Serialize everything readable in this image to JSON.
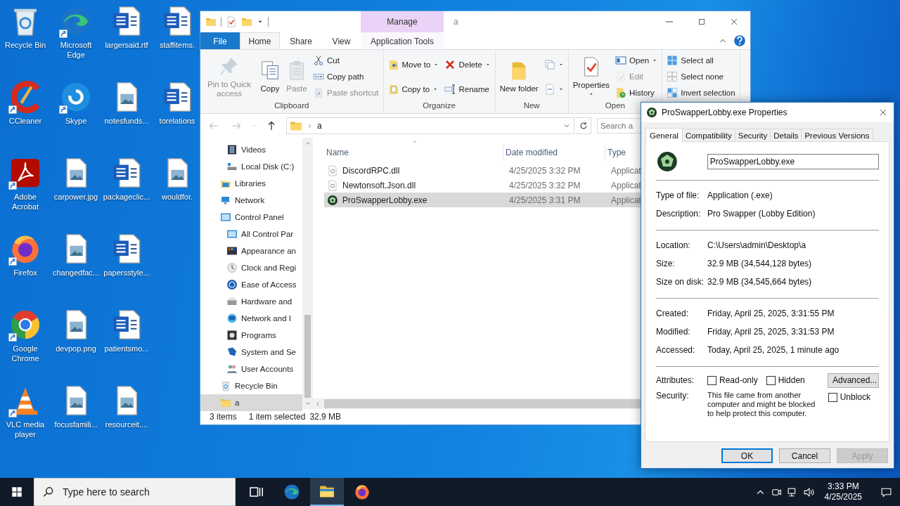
{
  "desktop": {
    "icons": [
      {
        "label": "Recycle Bin",
        "kind": "recycle",
        "shortcut": false
      },
      {
        "label": "CCleaner",
        "kind": "ccleaner",
        "shortcut": true
      },
      {
        "label": "Adobe Acrobat",
        "kind": "acrobat",
        "shortcut": true
      },
      {
        "label": "Firefox",
        "kind": "firefox",
        "shortcut": true
      },
      {
        "label": "Google Chrome",
        "kind": "chrome",
        "shortcut": true
      },
      {
        "label": "VLC media player",
        "kind": "vlc",
        "shortcut": true
      },
      {
        "label": "Microsoft Edge",
        "kind": "edge",
        "shortcut": true
      },
      {
        "label": "Skype",
        "kind": "skype",
        "shortcut": true
      },
      {
        "label": "carpower.jpg",
        "kind": "image",
        "shortcut": false
      },
      {
        "label": "changedfac...",
        "kind": "image",
        "shortcut": false
      },
      {
        "label": "devpop.png",
        "kind": "image",
        "shortcut": false
      },
      {
        "label": "focusfamili...",
        "kind": "image",
        "shortcut": false
      },
      {
        "label": "largersaid.rtf",
        "kind": "word",
        "shortcut": false
      },
      {
        "label": "notesfunds...",
        "kind": "image",
        "shortcut": false
      },
      {
        "label": "packageclic...",
        "kind": "word",
        "shortcut": false
      },
      {
        "label": "papersstyle...",
        "kind": "word",
        "shortcut": false
      },
      {
        "label": "patientsmo...",
        "kind": "word",
        "shortcut": false
      },
      {
        "label": "resourceit....",
        "kind": "image",
        "shortcut": false
      },
      {
        "label": "staffitems.",
        "kind": "word",
        "shortcut": false
      },
      {
        "label": "torelations",
        "kind": "word",
        "shortcut": false
      },
      {
        "label": "wouldfor.",
        "kind": "image",
        "shortcut": false
      }
    ]
  },
  "explorer": {
    "title": "a",
    "contextual_header": "Manage",
    "tabs": [
      {
        "label": "File",
        "kind": "file",
        "selected": false
      },
      {
        "label": "Home",
        "kind": "normal",
        "selected": true
      },
      {
        "label": "Share",
        "kind": "normal",
        "selected": false
      },
      {
        "label": "View",
        "kind": "normal",
        "selected": false
      },
      {
        "label": "Application Tools",
        "kind": "contextual",
        "selected": false
      }
    ],
    "ribbon": {
      "groups": [
        {
          "label": "Clipboard",
          "columns": [
            [
              {
                "label": "Pin to Quick access",
                "kind": "pin",
                "dropdown": false,
                "disabled": true
              }
            ],
            [
              {
                "label": "Copy",
                "kind": "copy",
                "dropdown": false,
                "disabled": false
              }
            ],
            [
              {
                "label": "Paste",
                "kind": "paste",
                "dropdown": false,
                "disabled": true
              }
            ],
            [
              {
                "label": "Cut",
                "kind": "cut",
                "dropdown": false,
                "disabled": false
              },
              {
                "label": "Copy path",
                "kind": "copypath",
                "dropdown": false,
                "disabled": false
              },
              {
                "label": "Paste shortcut",
                "kind": "pasteshortcut",
                "dropdown": false,
                "disabled": true
              }
            ]
          ]
        },
        {
          "label": "Organize",
          "columns": [
            [
              {
                "label": "Move to",
                "kind": "moveto",
                "dropdown": true,
                "disabled": false
              },
              {
                "label": "Copy to",
                "kind": "copyto",
                "dropdown": true,
                "disabled": false
              }
            ],
            [
              {
                "label": "Delete",
                "kind": "delete",
                "dropdown": true,
                "disabled": false
              },
              {
                "label": "Rename",
                "kind": "rename",
                "dropdown": false,
                "disabled": false
              }
            ]
          ]
        },
        {
          "label": "New",
          "columns": [
            [
              {
                "label": "New folder",
                "kind": "newfolder",
                "dropdown": false,
                "disabled": false
              }
            ],
            [
              {
                "kind": "newitem",
                "dropdown": true,
                "disabled": false
              },
              {
                "kind": "easyaccess",
                "dropdown": true,
                "disabled": false
              }
            ]
          ]
        },
        {
          "label": "Open",
          "columns": [
            [
              {
                "label": "Properties",
                "kind": "properties",
                "dropdown": true,
                "disabled": false
              }
            ],
            [
              {
                "label": "Open",
                "kind": "open",
                "dropdown": true,
                "disabled": false
              },
              {
                "label": "Edit",
                "kind": "edit",
                "dropdown": false,
                "disabled": true
              },
              {
                "label": "History",
                "kind": "history",
                "dropdown": false,
                "disabled": false
              }
            ]
          ]
        },
        {
          "columns": [
            [
              {
                "label": "Select all",
                "kind": "selectall",
                "dropdown": false,
                "disabled": false
              },
              {
                "label": "Select none",
                "kind": "selectnone",
                "dropdown": false,
                "disabled": false
              },
              {
                "label": "Invert selection",
                "kind": "invert",
                "dropdown": false,
                "disabled": false
              }
            ]
          ]
        }
      ]
    },
    "address": {
      "back_disabled": true,
      "forward_disabled": true,
      "path": [
        "a"
      ],
      "search_placeholder": "Search a"
    },
    "nav": [
      {
        "children": [
          {
            "label": "Videos",
            "kind": "video",
            "selected": false
          },
          {
            "label": "Local Disk (C:)",
            "kind": "disk",
            "selected": false
          }
        ]
      },
      {
        "label": "Libraries",
        "kind": "libraries",
        "selected": false
      },
      {
        "label": "Network",
        "kind": "network",
        "selected": false
      },
      {
        "label": "Control Panel",
        "kind": "control",
        "selected": false,
        "children": [
          {
            "label": "All Control Par",
            "kind": "control",
            "selected": false
          },
          {
            "label": "Appearance an",
            "kind": "appearance",
            "selected": false
          },
          {
            "label": "Clock and Regi",
            "kind": "clock",
            "selected": false
          },
          {
            "label": "Ease of Access",
            "kind": "ease",
            "selected": false
          },
          {
            "label": "Hardware and",
            "kind": "hardware",
            "selected": false
          },
          {
            "label": "Network and I",
            "kind": "netint",
            "selected": false
          },
          {
            "label": "Programs",
            "kind": "programs",
            "selected": false
          },
          {
            "label": "System and Se",
            "kind": "system",
            "selected": false
          },
          {
            "label": "User Accounts",
            "kind": "users",
            "selected": false
          }
        ]
      },
      {
        "label": "Recycle Bin",
        "kind": "recycle",
        "selected": false
      },
      {
        "label": "a",
        "kind": "folder",
        "selected": true
      }
    ],
    "columns": [
      {
        "label": "Name",
        "sorted": true
      },
      {
        "label": "Date modified",
        "sorted": false
      },
      {
        "label": "Type",
        "sorted": false
      }
    ],
    "files": [
      {
        "name": "DiscordRPC.dll",
        "kind": "dll",
        "date": "4/25/2025 3:32 PM",
        "type": "Applicat",
        "selected": false
      },
      {
        "name": "Newtonsoft.Json.dll",
        "kind": "dll",
        "date": "4/25/2025 3:32 PM",
        "type": "Applicat",
        "selected": false
      },
      {
        "name": "ProSwapperLobby.exe",
        "kind": "exe",
        "date": "4/25/2025 3:31 PM",
        "type": "Applicat",
        "selected": true
      }
    ],
    "status": {
      "count": "3 items",
      "selection": "1 item selected",
      "size": "32.9 MB"
    }
  },
  "properties": {
    "title": "ProSwapperLobby.exe Properties",
    "tabs": [
      {
        "label": "General",
        "selected": true
      },
      {
        "label": "Compatibility",
        "selected": false
      },
      {
        "label": "Security",
        "selected": false
      },
      {
        "label": "Details",
        "selected": false
      },
      {
        "label": "Previous Versions",
        "selected": false
      }
    ],
    "filename": "ProSwapperLobby.exe",
    "sections": [
      [
        {
          "label": "Type of file:",
          "value": "Application (.exe)"
        },
        {
          "label": "Description:",
          "value": "Pro Swapper (Lobby Edition)"
        }
      ],
      [
        {
          "label": "Location:",
          "value": "C:\\Users\\admin\\Desktop\\a"
        },
        {
          "label": "Size:",
          "value": "32.9 MB (34,544,128 bytes)"
        },
        {
          "label": "Size on disk:",
          "value": "32.9 MB (34,545,664 bytes)"
        }
      ],
      [
        {
          "label": "Created:",
          "value": "Friday, April 25, 2025, 3:31:55 PM"
        },
        {
          "label": "Modified:",
          "value": "Friday, April 25, 2025, 3:31:53 PM"
        },
        {
          "label": "Accessed:",
          "value": "Today, April 25, 2025, 1 minute ago"
        }
      ]
    ],
    "attributes_label": "Attributes:",
    "attributes": [
      {
        "label": "Read-only",
        "checked": false
      },
      {
        "label": "Hidden",
        "checked": false
      }
    ],
    "advanced_button": "Advanced...",
    "security_label": "Security:",
    "security_text": "This file came from another computer and might be blocked to help protect this computer.",
    "unblock": {
      "label": "Unblock",
      "checked": false
    },
    "buttons": [
      {
        "label": "OK",
        "kind": "default",
        "disabled": false
      },
      {
        "label": "Cancel",
        "kind": "normal",
        "disabled": false
      },
      {
        "label": "Apply",
        "kind": "normal",
        "disabled": true
      }
    ]
  },
  "taskbar": {
    "search_placeholder": "Type here to search",
    "apps": [
      {
        "kind": "taskview",
        "active": false
      },
      {
        "kind": "edge",
        "active": false
      },
      {
        "kind": "explorer",
        "active": true
      },
      {
        "kind": "firefox",
        "active": false
      }
    ],
    "time": "3:33 PM",
    "date": "4/25/2025"
  }
}
